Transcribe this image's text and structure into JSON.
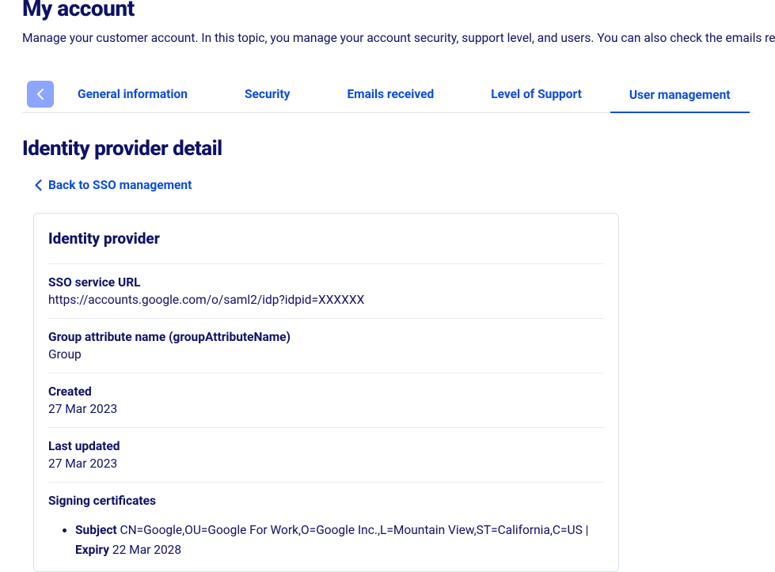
{
  "header": {
    "title": "My account",
    "description": "Manage your customer account. In this topic, you manage your account security, support level, and users. You can also check the emails receive services."
  },
  "tabs": {
    "items": [
      {
        "label": "General information"
      },
      {
        "label": "Security"
      },
      {
        "label": "Emails received"
      },
      {
        "label": "Level of Support"
      },
      {
        "label": "User management"
      }
    ]
  },
  "section": {
    "title": "Identity provider detail",
    "back_link": "Back to SSO management"
  },
  "card": {
    "title": "Identity provider",
    "sso_url": {
      "label": "SSO service URL",
      "value": "https://accounts.google.com/o/saml2/idp?idpid=XXXXXX"
    },
    "group_attr": {
      "label": "Group attribute name (groupAttributeName)",
      "value": "Group"
    },
    "created": {
      "label": "Created",
      "value": "27 Mar 2023"
    },
    "updated": {
      "label": "Last updated",
      "value": "27 Mar 2023"
    },
    "certs": {
      "label": "Signing certificates",
      "subject_label": "Subject",
      "subject_value": "CN=Google,OU=Google For Work,O=Google Inc.,L=Mountain View,ST=California,C=US |",
      "expiry_label": "Expiry",
      "expiry_value": "22 Mar 2028"
    }
  }
}
